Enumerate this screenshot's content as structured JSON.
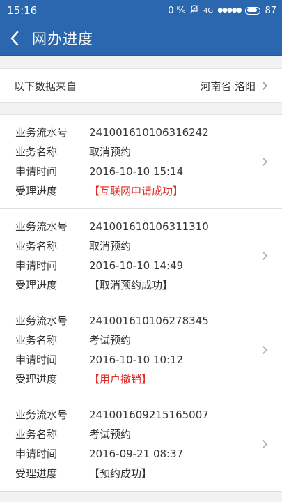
{
  "status_bar": {
    "time": "15:16",
    "net_speed": "0 ᴷ⁄ₛ",
    "network": "4G",
    "signal": "●●●●●",
    "battery": "87"
  },
  "header": {
    "title": "网办进度"
  },
  "source": {
    "label": "以下数据来自",
    "value": "河南省 洛阳"
  },
  "labels": {
    "serial": "业务流水号",
    "name": "业务名称",
    "time": "申请时间",
    "progress": "受理进度"
  },
  "records": [
    {
      "serial": "241001610106316242",
      "name": "取消预约",
      "time": "2016-10-10 15:14",
      "progress": "【互联网申请成功】",
      "progress_color": "#e02b27"
    },
    {
      "serial": "241001610106311310",
      "name": "取消预约",
      "time": "2016-10-10 14:49",
      "progress": "【取消预约成功】",
      "progress_color": "#333333"
    },
    {
      "serial": "241001610106278345",
      "name": "考试预约",
      "time": "2016-10-10 10:12",
      "progress": "【用户撤销】",
      "progress_color": "#e02b27"
    },
    {
      "serial": "241001609215165007",
      "name": "考试预约",
      "time": "2016-09-21 08:37",
      "progress": "【预约成功】",
      "progress_color": "#333333"
    }
  ],
  "colors": {
    "primary": "#2a67ae",
    "status_red": "#e02b27"
  }
}
